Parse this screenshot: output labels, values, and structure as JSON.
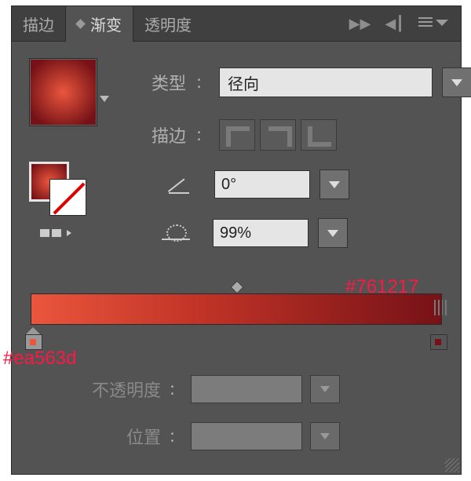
{
  "tabs": {
    "stroke": "描边",
    "gradient": "渐变",
    "transparency": "透明度"
  },
  "labels": {
    "type": "类型",
    "stroke": "描边",
    "opacity": "不透明度",
    "position": "位置"
  },
  "type": {
    "value": "径向"
  },
  "angle": {
    "value": "0°"
  },
  "scale": {
    "value": "99%"
  },
  "gradient": {
    "stops": [
      {
        "offset": 0,
        "color": "#ea563d"
      },
      {
        "offset": 100,
        "color": "#761217"
      }
    ]
  },
  "annotations": {
    "left": "#ea563d",
    "right": "#761217"
  },
  "icons": {
    "forward": "▶▶",
    "divider": "◀┃",
    "colon": "："
  }
}
